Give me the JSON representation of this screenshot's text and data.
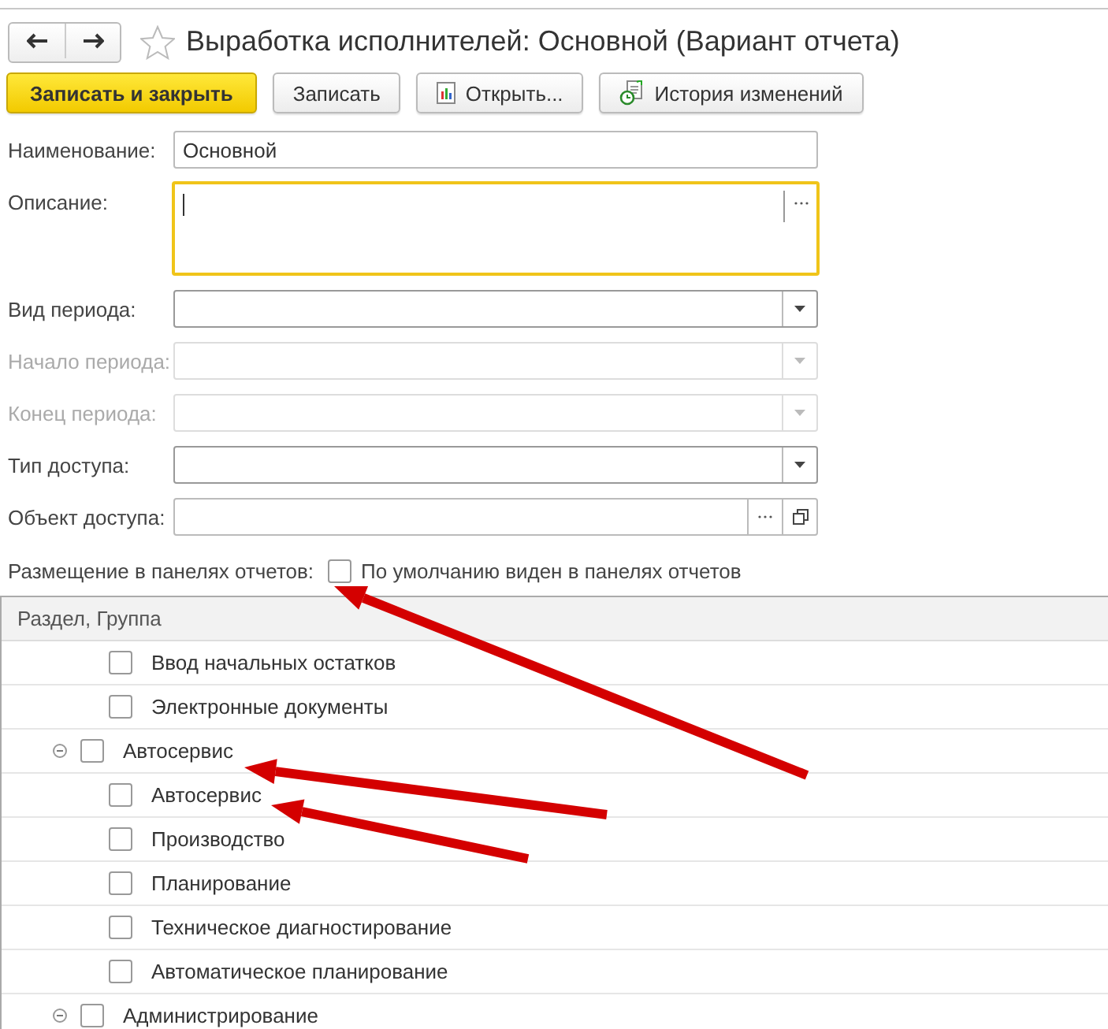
{
  "window": {
    "title": "Выработка исполнителей: Основной (Вариант отчета)",
    "favorite": false
  },
  "toolbar": {
    "buttons": [
      {
        "label": "Записать и закрыть",
        "kind": "primary"
      },
      {
        "label": "Записать",
        "kind": "plain"
      },
      {
        "label": "Открыть...",
        "kind": "open"
      },
      {
        "label": "История изменений",
        "kind": "history"
      }
    ]
  },
  "fields": [
    {
      "label": "Наименование:",
      "kind": "text",
      "value": "Основной",
      "disabled": false,
      "focused": false
    },
    {
      "label": "Описание:",
      "kind": "textarea",
      "disabled": false,
      "focused": true
    },
    {
      "label": "Вид периода:",
      "kind": "select",
      "disabled": false,
      "focused": false
    },
    {
      "label": "Начало периода:",
      "kind": "select",
      "disabled": true,
      "focused": false
    },
    {
      "label": "Конец периода:",
      "kind": "select",
      "disabled": true,
      "focused": false
    },
    {
      "label": "Тип доступа:",
      "kind": "select",
      "disabled": false,
      "focused": false
    },
    {
      "label": "Объект доступа:",
      "kind": "choice",
      "disabled": false,
      "focused": false
    }
  ],
  "placement": {
    "label": "Размещение в панелях отчетов:",
    "checkbox_label": "По умолчанию виден в панелях отчетов",
    "checked": false
  },
  "tree": {
    "column": "Раздел, Группа",
    "items": [
      {
        "label": "Ввод начальных остатков",
        "checked": false
      },
      {
        "label": "Электронные документы",
        "checked": false
      },
      {
        "label": "Автосервис",
        "checked": false,
        "expanded": true,
        "children": [
          {
            "label": "Автосервис",
            "checked": false
          },
          {
            "label": "Производство",
            "checked": false
          },
          {
            "label": "Планирование",
            "checked": false
          },
          {
            "label": "Техническое диагностирование",
            "checked": false
          },
          {
            "label": "Автоматическое планирование",
            "checked": false
          }
        ]
      },
      {
        "label": "Администрирование",
        "checked": false,
        "expanded": true
      }
    ]
  }
}
